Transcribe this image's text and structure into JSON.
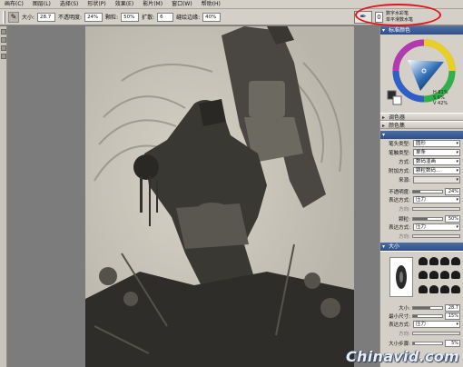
{
  "menubar": {
    "items": [
      {
        "label": "画布(C)",
        "icon": ""
      },
      {
        "label": "图层(L)",
        "icon": ""
      },
      {
        "label": "选择(S)",
        "icon": ""
      },
      {
        "label": "形状(P)",
        "icon": ""
      },
      {
        "label": "效果(E)",
        "icon": ""
      },
      {
        "label": "影片(M)",
        "icon": ""
      },
      {
        "label": "窗口(W)",
        "icon": ""
      },
      {
        "label": "帮助(H)",
        "icon": ""
      }
    ]
  },
  "propbar": {
    "size_label": "大小:",
    "size_value": "28.7",
    "opacity_label": "不透明度:",
    "opacity_value": "24%",
    "grain_label": "颗粒:",
    "grain_value": "50%",
    "expression_label": "扩散:",
    "expression_value": "6",
    "bleed_label": "缝绘边缘:",
    "bleed_value": "40%"
  },
  "brush_selector": {
    "number": "0",
    "category": "数字水彩笔",
    "variant": "单平滑数水笔"
  },
  "panels": {
    "color_title": "标准颜色",
    "mixer_title": "调色器",
    "color_sets_title": "颜色集",
    "hsv": {
      "h": "H 81%",
      "s": "S 6%",
      "v": "V 42%"
    },
    "brush_controls": {
      "dab_type_label": "笔头类型:",
      "dab_type_value": "圆形",
      "stroke_type_label": "笔触类型:",
      "stroke_type_value": "单条",
      "method_label": "方式:",
      "method_value": "数码湿画",
      "submethod_label": "附加方式:",
      "submethod_value": "颗粒数码...",
      "source_label": "来源:",
      "source_value": "",
      "opacity_label": "不透明度:",
      "opacity_value": "24%",
      "expression_label": "表达方式:",
      "expression_value": "压力",
      "direction_label": "方向:",
      "grain_label": "颗粒:",
      "grain_value": "50%",
      "grain_expr_label": "表达方式:",
      "grain_expr_value": "压力",
      "grain_dir_label": "方向:"
    },
    "size_title": "大小",
    "size": {
      "size_label": "大小:",
      "size_value": "28.7",
      "min_label": "最小尺寸:",
      "min_value": "15%",
      "expr_label": "表达方式:",
      "expr_value": "压力",
      "dir_label": "方向:",
      "step_label": "大小步骤:",
      "step_value": "5%"
    }
  },
  "watermark": "Chinavid.com",
  "colors": {
    "highlight": "#e0141c",
    "title_bar": "#2f4f86"
  }
}
